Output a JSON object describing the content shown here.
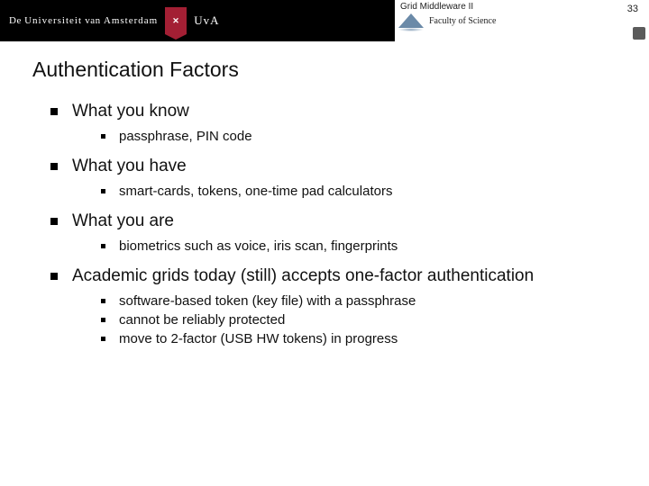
{
  "header": {
    "brand_pre": "De",
    "brand_mid": "Universiteit",
    "brand_post": "van",
    "brand_city": "Amsterdam",
    "uva": "UvA",
    "course": "Grid Middleware II",
    "faculty": "Faculty of Science",
    "slide_number": "33"
  },
  "title": "Authentication Factors",
  "bullets": [
    {
      "text": "What you know",
      "sub": [
        "passphrase, PIN code"
      ]
    },
    {
      "text": "What you have",
      "sub": [
        "smart-cards, tokens, one-time pad calculators"
      ]
    },
    {
      "text": "What you are",
      "sub": [
        "biometrics such as voice, iris scan, fingerprints"
      ]
    },
    {
      "text": "Academic grids today (still) accepts one-factor authentication",
      "sub": [
        "software-based token (key file) with a passphrase",
        "cannot be reliably protected",
        "move to 2-factor (USB HW tokens) in progress"
      ]
    }
  ]
}
